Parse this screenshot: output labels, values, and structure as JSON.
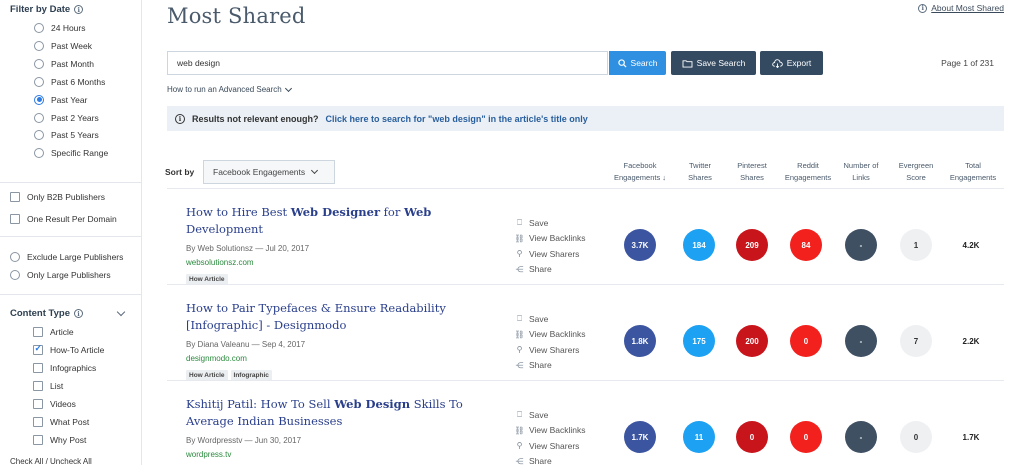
{
  "sidebar": {
    "filter_by_date": {
      "heading": "Filter by Date",
      "options": [
        "24 Hours",
        "Past Week",
        "Past Month",
        "Past 6 Months",
        "Past Year",
        "Past 2 Years",
        "Past 5 Years",
        "Specific Range"
      ],
      "selected": "Past Year"
    },
    "b2b_label": "Only B2B Publishers",
    "one_result_label": "One Result Per Domain",
    "exclude_large_label": "Exclude Large Publishers",
    "only_large_label": "Only Large Publishers",
    "content_type": {
      "heading": "Content Type",
      "options": [
        "Article",
        "How-To Article",
        "Infographics",
        "List",
        "Videos",
        "What Post",
        "Why Post"
      ],
      "checked": [
        "How-To Article"
      ]
    },
    "check_all_label": "Check All / Uncheck All"
  },
  "header": {
    "title": "Most Shared",
    "about_link": "About Most Shared"
  },
  "search": {
    "value": "web design",
    "search_button": "Search",
    "save_button": "Save Search",
    "export_button": "Export",
    "page_info": "Page 1 of 231",
    "advanced_link": "How to run an Advanced Search"
  },
  "notice": {
    "prefix": "Results not relevant enough?",
    "link": "Click here to search for \"web design\" in the article's title only"
  },
  "sort": {
    "label": "Sort by",
    "selected": "Facebook Engagements"
  },
  "columns": {
    "facebook": "Facebook Engagements ↓",
    "twitter": "Twitter Shares",
    "pinterest": "Pinterest Shares",
    "reddit": "Reddit Engagements",
    "links": "Number of Links",
    "evergreen": "Evergreen Score",
    "total": "Total Engagements"
  },
  "actions": {
    "save": "Save",
    "backlinks": "View Backlinks",
    "sharers": "View Sharers",
    "share": "Share"
  },
  "results": [
    {
      "title_parts": [
        {
          "t": "How to Hire Best ",
          "b": false
        },
        {
          "t": "Web Designer",
          "b": true
        },
        {
          "t": " for ",
          "b": false
        },
        {
          "t": "Web",
          "b": true
        },
        {
          "t": " Development",
          "b": false
        }
      ],
      "author": "By Web Solutionsz",
      "date": "Jul 20, 2017",
      "domain": "websolutionsz.com",
      "tags": [
        "How Article"
      ],
      "facebook": "3.7K",
      "twitter": "184",
      "pinterest": "209",
      "reddit": "84",
      "links": "-",
      "evergreen": "1",
      "total": "4.2K"
    },
    {
      "title_parts": [
        {
          "t": "How to Pair Typefaces & Ensure Readability [Infographic] - Designmodo",
          "b": false
        }
      ],
      "author": "By Diana Valeanu",
      "date": "Sep 4, 2017",
      "domain": "designmodo.com",
      "tags": [
        "How Article",
        "Infographic"
      ],
      "facebook": "1.8K",
      "twitter": "175",
      "pinterest": "200",
      "reddit": "0",
      "links": "-",
      "evergreen": "7",
      "total": "2.2K"
    },
    {
      "title_parts": [
        {
          "t": "Kshitij Patil: How To Sell ",
          "b": false
        },
        {
          "t": "Web Design",
          "b": true
        },
        {
          "t": " Skills To Average Indian Businesses",
          "b": false
        }
      ],
      "author": "By Wordpresstv",
      "date": "Jun 30, 2017",
      "domain": "wordpress.tv",
      "tags": [],
      "facebook": "1.7K",
      "twitter": "11",
      "pinterest": "0",
      "reddit": "0",
      "links": "-",
      "evergreen": "0",
      "total": "1.7K"
    }
  ]
}
